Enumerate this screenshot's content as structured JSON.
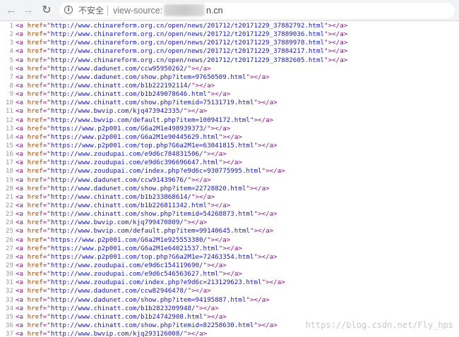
{
  "browser": {
    "security_label": "不安全",
    "url_prefix": "view-source:",
    "url_suffix": "n.cn",
    "back_glyph": "←",
    "forward_glyph": "→",
    "reload_glyph": "↻",
    "info_glyph": "i"
  },
  "source": {
    "tag_open": "<a ",
    "attr_name": "href",
    "eq_quote": "=\"",
    "close_quote": "\"",
    "tag_mid": ">",
    "tag_close": "</a>",
    "lines": [
      {
        "num": "1",
        "href": "http://www.chinareform.org.cn/open/news/201712/t20171229_37882792.html"
      },
      {
        "num": "2",
        "href": "http://www.chinareform.org.cn/open/news/201712/t20171229_37889036.html"
      },
      {
        "num": "3",
        "href": "http://www.chinareform.org.cn/open/news/201712/t20171229_37889978.html"
      },
      {
        "num": "4",
        "href": "http://www.chinareform.org.cn/open/news/201712/t20171229_37884217.html"
      },
      {
        "num": "5",
        "href": "http://www.chinareform.org.cn/open/news/201712/t20171229_37882605.html"
      },
      {
        "num": "6",
        "href": "http://www.dadunet.com/ccw95950262/"
      },
      {
        "num": "7",
        "href": "http://www.dadunet.com/show.php?item=97650509.html"
      },
      {
        "num": "8",
        "href": "http://www.chinatt.com/b1b222192114/"
      },
      {
        "num": "9",
        "href": "http://www.chinatt.com/b1b249078646.html"
      },
      {
        "num": "10",
        "href": "http://www.chinatt.com/show.php?itemid=75131719.html"
      },
      {
        "num": "11",
        "href": "http://www.bwvip.com/kjq473942335/"
      },
      {
        "num": "12",
        "href": "http://www.bwvip.com/default.php?item=10094172.html"
      },
      {
        "num": "13",
        "href": "https://www.p2p001.com/G6a2M1e498939373/"
      },
      {
        "num": "14",
        "href": "https://www.p2p001.com/G6a2M1e90445629.html"
      },
      {
        "num": "15",
        "href": "https://www.p2p001.com/top.php?G6a2M1e=63041815.html"
      },
      {
        "num": "16",
        "href": "http://www.zoudupai.com/e9d6c784831506/"
      },
      {
        "num": "17",
        "href": "http://www.zoudupai.com/e9d6c396696647.html"
      },
      {
        "num": "18",
        "href": "http://www.zoudupai.com/index.php?e9d6c=930775995.html"
      },
      {
        "num": "19",
        "href": "http://www.dadunet.com/ccw91439676/"
      },
      {
        "num": "20",
        "href": "http://www.dadunet.com/show.php?item=22728820.html"
      },
      {
        "num": "21",
        "href": "http://www.chinatt.com/b1b233868614/"
      },
      {
        "num": "22",
        "href": "http://www.chinatt.com/b1b226811342.html"
      },
      {
        "num": "23",
        "href": "http://www.chinatt.com/show.php?itemid=54268873.html"
      },
      {
        "num": "24",
        "href": "http://www.bwvip.com/kjq799470809/"
      },
      {
        "num": "25",
        "href": "http://www.bwvip.com/default.php?item=99140645.html"
      },
      {
        "num": "26",
        "href": "https://www.p2p001.com/G6a2M1e925553380/"
      },
      {
        "num": "27",
        "href": "https://www.p2p001.com/G6a2M1e64021537.html"
      },
      {
        "num": "28",
        "href": "https://www.p2p001.com/top.php?G6a2M1e=72463354.html"
      },
      {
        "num": "29",
        "href": "http://www.zoudupai.com/e9d6c154119690/"
      },
      {
        "num": "30",
        "href": "http://www.zoudupai.com/e9d6c546563627.html"
      },
      {
        "num": "31",
        "href": "http://www.zoudupai.com/index.php?e9d6c=213129623.html"
      },
      {
        "num": "32",
        "href": "http://www.dadunet.com/ccw82946478/"
      },
      {
        "num": "33",
        "href": "http://www.dadunet.com/show.php?item=94195887.html"
      },
      {
        "num": "34",
        "href": "http://www.chinatt.com/b1b2823209948/"
      },
      {
        "num": "35",
        "href": "http://www.chinatt.com/b1b24742908.html"
      },
      {
        "num": "36",
        "href": "http://www.chinatt.com/show.php?itemid=82258630.html"
      },
      {
        "num": "37",
        "href": "http://www.bwvip.com/kjq293126008/"
      }
    ]
  },
  "watermark": "https://blog.csdn.net/Fly_hps"
}
